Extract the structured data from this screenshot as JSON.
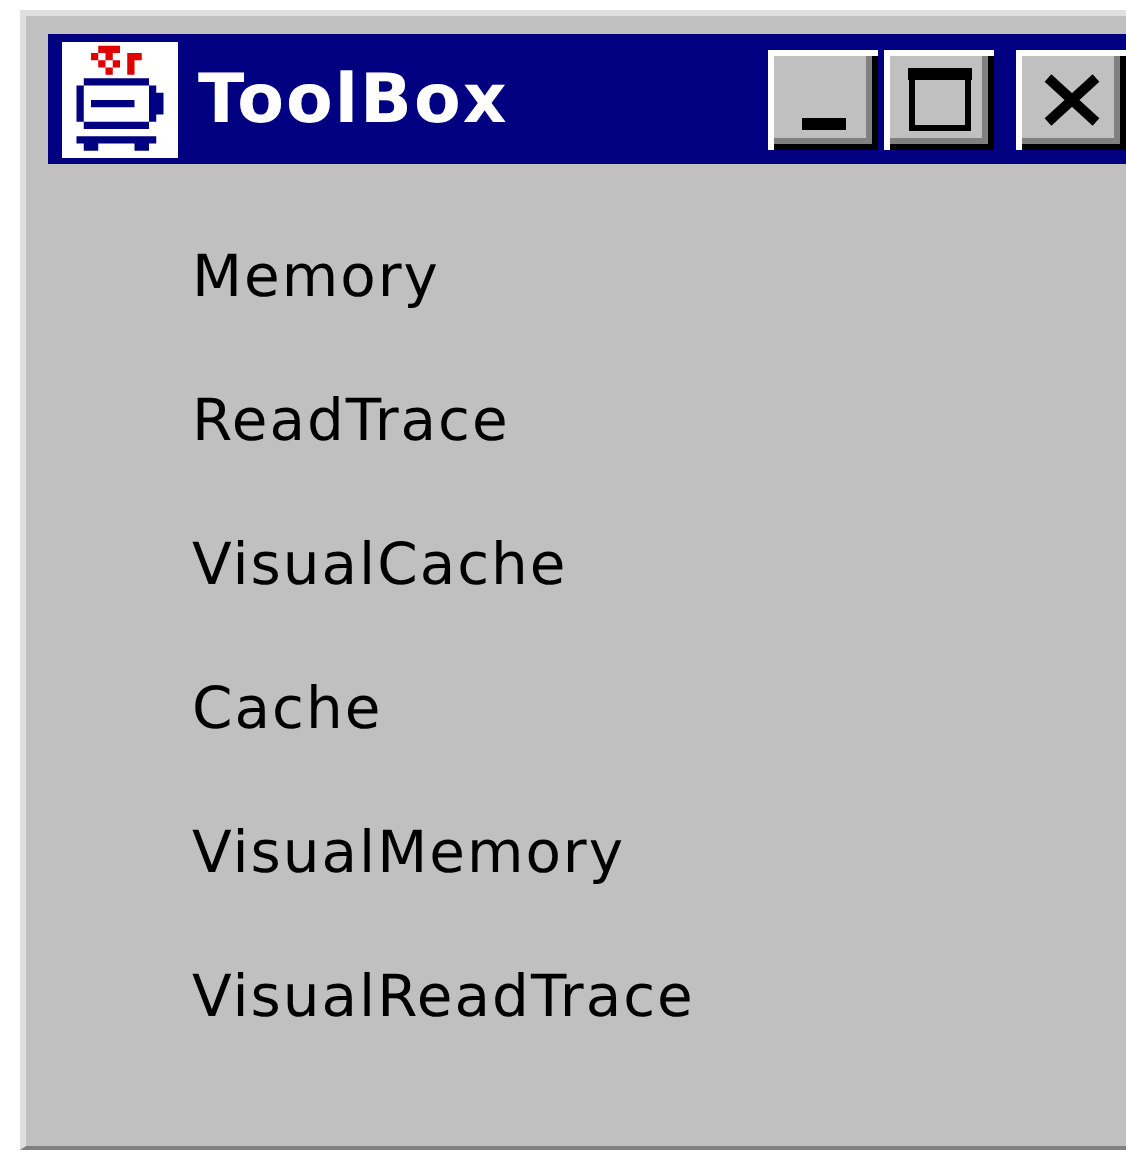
{
  "window": {
    "title": "ToolBox"
  },
  "items": [
    "Memory",
    "ReadTrace",
    "VisualCache",
    "Cache",
    "VisualMemory",
    "VisualReadTrace"
  ]
}
